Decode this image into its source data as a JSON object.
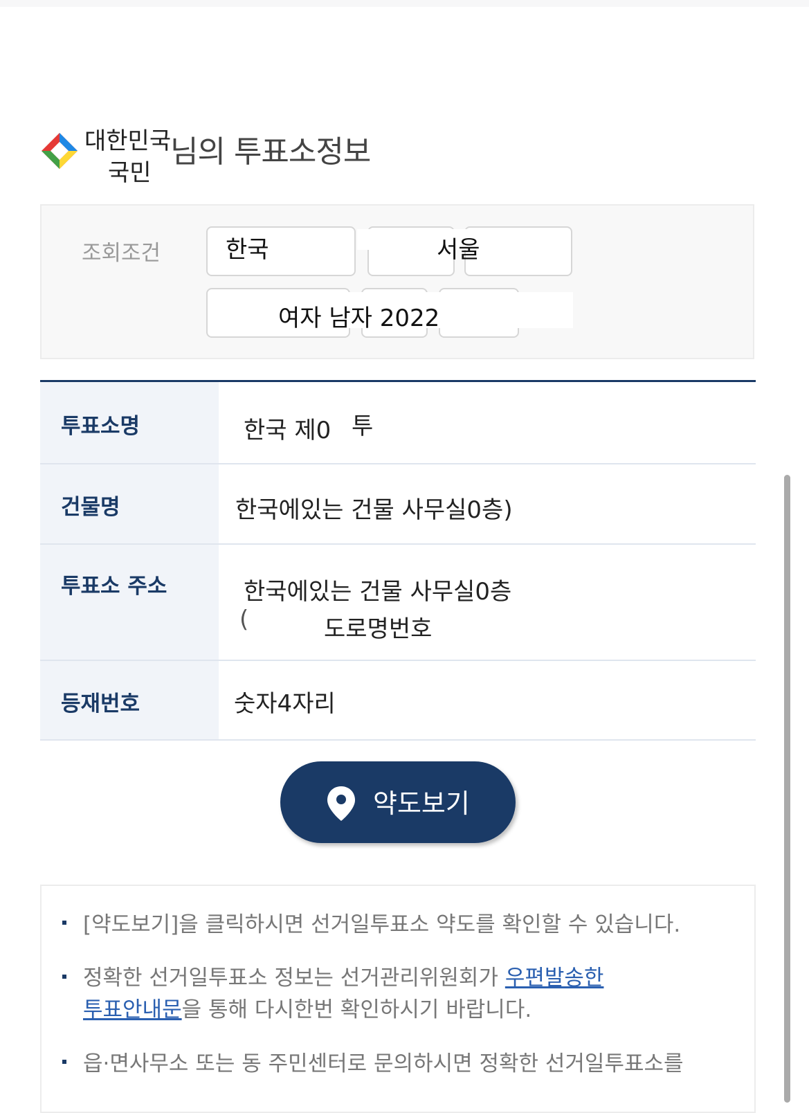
{
  "header": {
    "name_line1": "대한민국",
    "name_line2": "국민",
    "title_suffix": "님의 투표소정보"
  },
  "query": {
    "label": "조회조건",
    "select_region": "한국",
    "select_city": "서울",
    "select_gender_text": "여자 남자 2022"
  },
  "info": {
    "rows": [
      {
        "label": "투표소명",
        "value": "한국 제0",
        "value_extra": "투"
      },
      {
        "label": "건물명",
        "value": "한국에있는 건물 사무실0층)"
      },
      {
        "label": "투표소 주소",
        "value_line1": "한국에있는 건물 사무실0층",
        "value_line2_prefix": "(",
        "value_line2": "도로명번호"
      },
      {
        "label": "등재번호",
        "value": "숫자4자리"
      }
    ]
  },
  "map_button": {
    "label": "약도보기",
    "icon": "map-pin-icon"
  },
  "notice": {
    "item1": "[약도보기]을 클릭하시면 선거일투표소 약도를 확인할 수 있습니다.",
    "item2_pre": "정확한 선거일투표소 정보는 선거관리위원회가 ",
    "item2_link_a": "우편발송한",
    "item2_link_b": "투표안내문",
    "item2_post": "을 통해 다시한번 확인하시기 바랍니다.",
    "item3": "읍·면사무소 또는 동 주민센터로 문의하시면 정확한 선거일투표소를"
  },
  "colors": {
    "navy": "#1a3a66",
    "header_cell_bg": "#f1f4f9",
    "link": "#2a5fb0"
  }
}
